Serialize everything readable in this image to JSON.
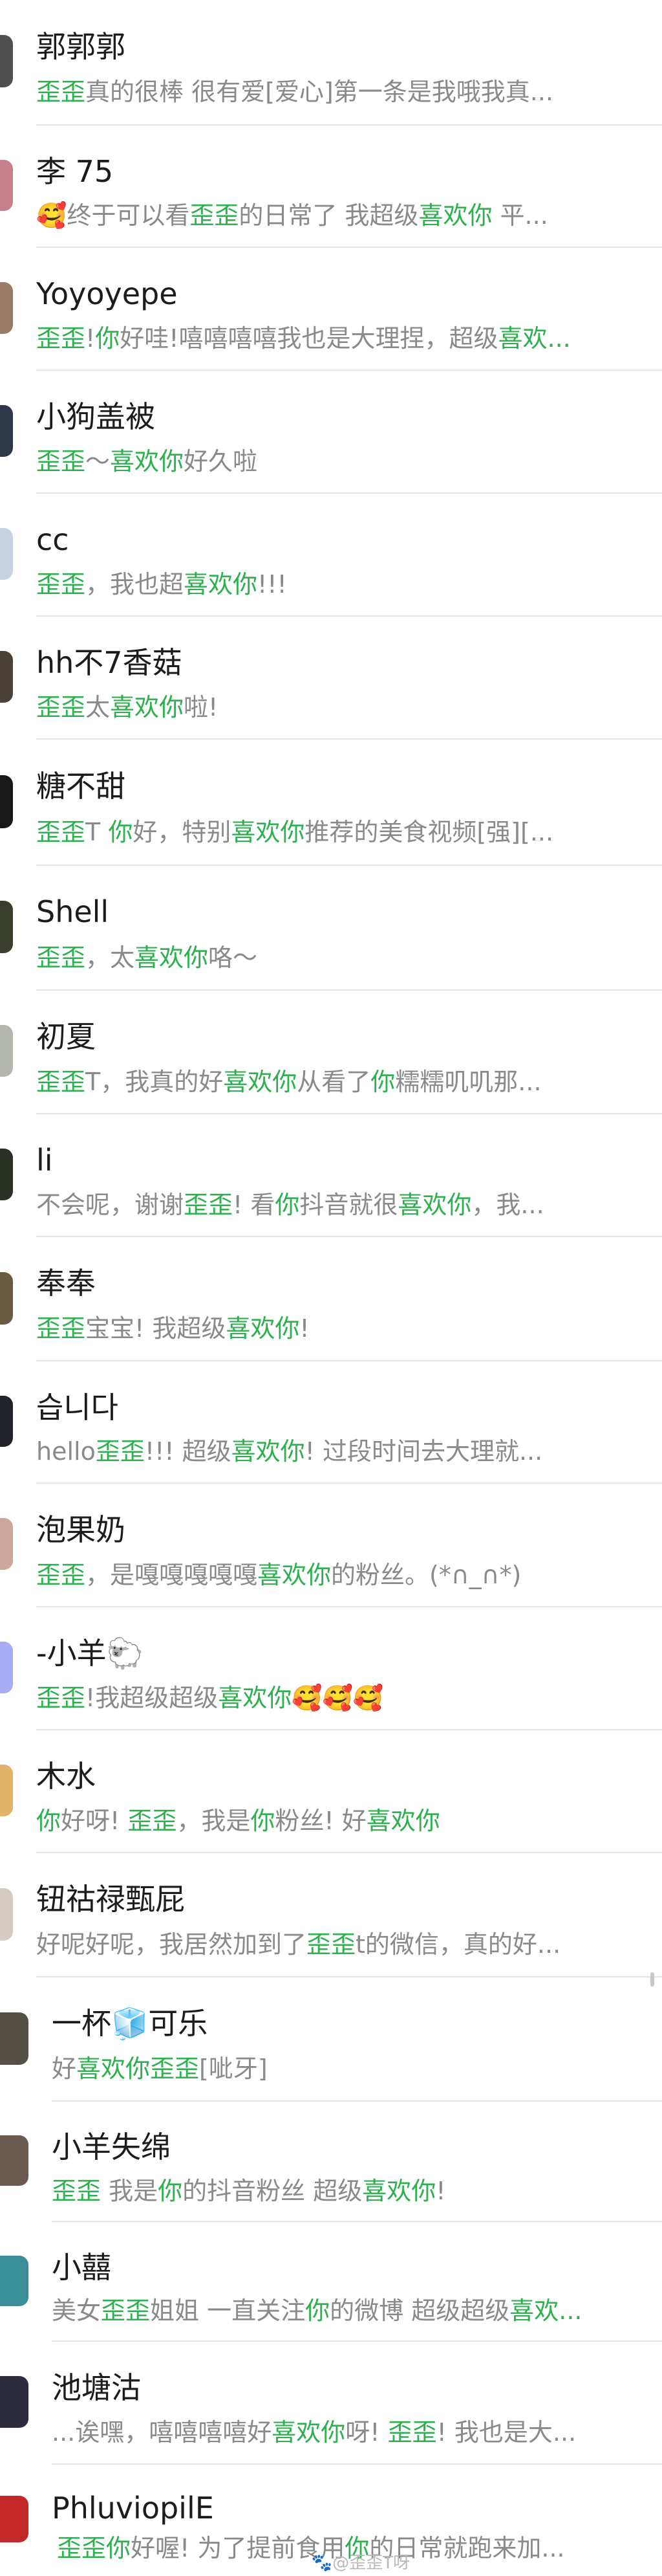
{
  "accent_color": "#2eb04f",
  "contacts": [
    {
      "name": "郭郭郭",
      "avatar_color": "#505050",
      "message": [
        {
          "t": "歪歪",
          "hl": true
        },
        {
          "t": "真的很棒 很有爱[爱心]第一条是我哦我真..."
        }
      ]
    },
    {
      "name": "李 75",
      "avatar_color": "#c5808e",
      "message": [
        {
          "t": "🥰终于可以看"
        },
        {
          "t": "歪歪",
          "hl": true
        },
        {
          "t": "的日常了 我超级"
        },
        {
          "t": "喜欢你",
          "hl": true
        },
        {
          "t": " 平..."
        }
      ]
    },
    {
      "name": "Yoyoyepe",
      "avatar_color": "#9a7a66",
      "message": [
        {
          "t": "歪歪",
          "hl": true
        },
        {
          "t": "!"
        },
        {
          "t": "你",
          "hl": true
        },
        {
          "t": "好哇!嘻嘻嘻嘻我也是大理捏，超级"
        },
        {
          "t": "喜欢...",
          "hl": true
        }
      ]
    },
    {
      "name": "小狗盖被",
      "avatar_color": "#2e3648",
      "message": [
        {
          "t": "歪歪",
          "hl": true
        },
        {
          "t": "～"
        },
        {
          "t": "喜欢你",
          "hl": true
        },
        {
          "t": "好久啦"
        }
      ]
    },
    {
      "name": "cc",
      "avatar_color": "#c9d2e2",
      "message": [
        {
          "t": "歪歪",
          "hl": true
        },
        {
          "t": "，我也超"
        },
        {
          "t": "喜欢你",
          "hl": true
        },
        {
          "t": "!!!"
        }
      ]
    },
    {
      "name": "hh不7香菇",
      "avatar_color": "#4a4238",
      "message": [
        {
          "t": "歪歪",
          "hl": true
        },
        {
          "t": "太"
        },
        {
          "t": "喜欢你",
          "hl": true
        },
        {
          "t": "啦!"
        }
      ]
    },
    {
      "name": "糖不甜",
      "avatar_color": "#181818",
      "message": [
        {
          "t": "歪歪",
          "hl": true
        },
        {
          "t": "T "
        },
        {
          "t": "你",
          "hl": true
        },
        {
          "t": "好，特别"
        },
        {
          "t": "喜欢你",
          "hl": true
        },
        {
          "t": "推荐的美食视频[强][..."
        }
      ]
    },
    {
      "name": "Shell",
      "avatar_color": "#3a3e2e",
      "message": [
        {
          "t": "歪歪",
          "hl": true
        },
        {
          "t": "，太"
        },
        {
          "t": "喜欢你",
          "hl": true
        },
        {
          "t": "咯～"
        }
      ]
    },
    {
      "name": "初夏",
      "avatar_color": "#b3b6ad",
      "message": [
        {
          "t": "歪歪",
          "hl": true
        },
        {
          "t": "T，我真的好"
        },
        {
          "t": "喜欢你",
          "hl": true
        },
        {
          "t": "从看了"
        },
        {
          "t": "你",
          "hl": true
        },
        {
          "t": "糯糯叽叽那..."
        }
      ]
    },
    {
      "name": "li",
      "avatar_color": "#2a3226",
      "message": [
        {
          "t": "不会呢，谢谢"
        },
        {
          "t": "歪歪",
          "hl": true
        },
        {
          "t": "! 看"
        },
        {
          "t": "你",
          "hl": true
        },
        {
          "t": "抖音就很"
        },
        {
          "t": "喜欢你",
          "hl": true
        },
        {
          "t": "，我..."
        }
      ]
    },
    {
      "name": "奉奉",
      "avatar_color": "#6a5a40",
      "message": [
        {
          "t": "歪歪",
          "hl": true
        },
        {
          "t": "宝宝! 我超级"
        },
        {
          "t": "喜欢你",
          "hl": true
        },
        {
          "t": "!"
        }
      ]
    },
    {
      "name": "습니다",
      "avatar_color": "#22232a",
      "message": [
        {
          "t": "hello"
        },
        {
          "t": "歪歪",
          "hl": true
        },
        {
          "t": "!!! 超级"
        },
        {
          "t": "喜欢你",
          "hl": true
        },
        {
          "t": "! 过段时间去大理就..."
        }
      ]
    },
    {
      "name": "泡果奶",
      "avatar_color": "#caa79a",
      "message": [
        {
          "t": "歪歪",
          "hl": true
        },
        {
          "t": "，是嘎嘎嘎嘎嘎"
        },
        {
          "t": "喜欢你",
          "hl": true
        },
        {
          "t": "的粉丝。(*∩_∩*)"
        }
      ]
    },
    {
      "name": "-小羊🐑",
      "avatar_color": "#a9abf4",
      "message": [
        {
          "t": "歪歪",
          "hl": true
        },
        {
          "t": "!我超级超级"
        },
        {
          "t": "喜欢你",
          "hl": true
        },
        {
          "t": "🥰🥰🥰"
        }
      ]
    },
    {
      "name": "木水",
      "avatar_color": "#e2b26a",
      "message": [
        {
          "t": "你",
          "hl": true
        },
        {
          "t": "好呀! "
        },
        {
          "t": "歪歪",
          "hl": true
        },
        {
          "t": "，我是"
        },
        {
          "t": "你",
          "hl": true
        },
        {
          "t": "粉丝! 好"
        },
        {
          "t": "喜欢你",
          "hl": true
        }
      ]
    },
    {
      "name": "钮祜禄甄屁",
      "avatar_color": "#d4ccc2",
      "message": [
        {
          "t": "好呢好呢，我居然加到了"
        },
        {
          "t": "歪歪",
          "hl": true
        },
        {
          "t": "t的微信，真的好..."
        }
      ]
    },
    {
      "name": "一杯🧊可乐",
      "avatar_color": "#545048",
      "message": [
        {
          "t": "好"
        },
        {
          "t": "喜欢你歪歪",
          "hl": true
        },
        {
          "t": "[呲牙]"
        }
      ]
    },
    {
      "name": "小羊失绵",
      "avatar_color": "#6a5a52",
      "message": [
        {
          "t": "歪歪",
          "hl": true
        },
        {
          "t": " 我是"
        },
        {
          "t": "你",
          "hl": true
        },
        {
          "t": "的抖音粉丝 超级"
        },
        {
          "t": "喜欢你",
          "hl": true
        },
        {
          "t": "!"
        }
      ]
    },
    {
      "name": "小囍",
      "avatar_color": "#3a8e98",
      "message": [
        {
          "t": "美女"
        },
        {
          "t": "歪歪",
          "hl": true
        },
        {
          "t": "姐姐 一直关注"
        },
        {
          "t": "你",
          "hl": true
        },
        {
          "t": "的微博 超级超级"
        },
        {
          "t": "喜欢...",
          "hl": true
        }
      ]
    },
    {
      "name": "池塘沽",
      "avatar_color": "#2c2c3a",
      "message": [
        {
          "t": "...诶嘿，嘻嘻嘻嘻好"
        },
        {
          "t": "喜欢你",
          "hl": true
        },
        {
          "t": "呀! "
        },
        {
          "t": "歪歪",
          "hl": true
        },
        {
          "t": "! 我也是大..."
        }
      ]
    },
    {
      "name": "PhluviopilE",
      "avatar_color": "#c22828",
      "message": [
        {
          "t": "歪歪你",
          "hl": true
        },
        {
          "t": "好喔! 为了提前食用"
        },
        {
          "t": "你",
          "hl": true
        },
        {
          "t": "的日常就跑来加..."
        }
      ]
    }
  ],
  "watermark": "🐾@歪歪T呀"
}
